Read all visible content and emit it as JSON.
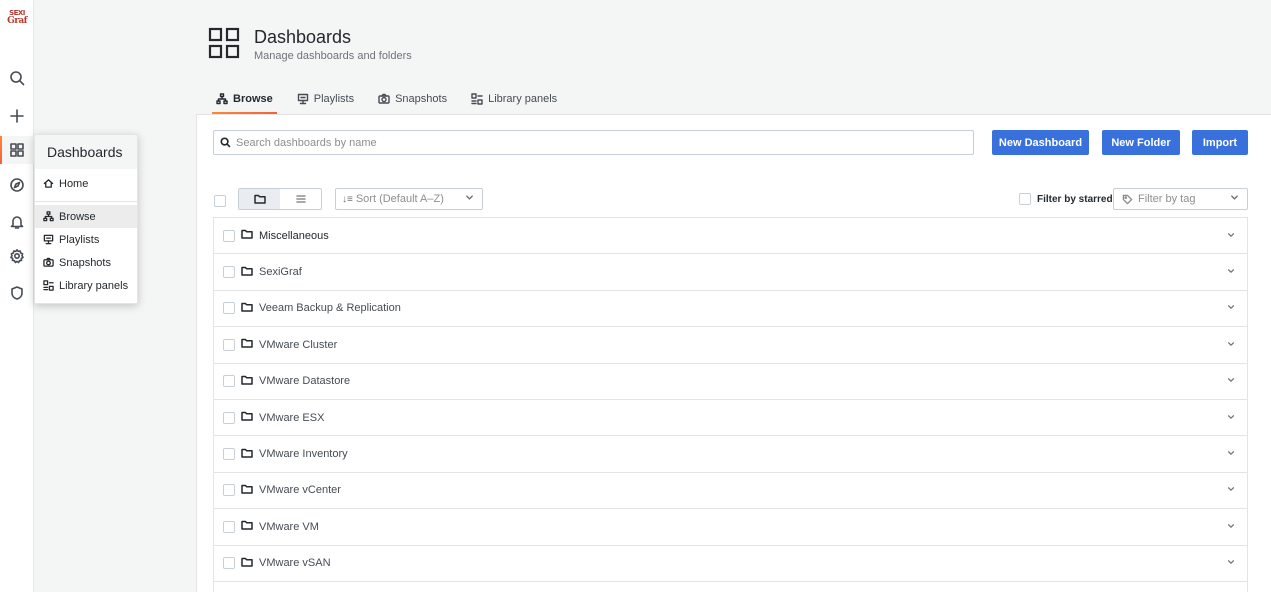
{
  "app": {
    "logo_line1": "SEXI",
    "logo_line2": "Graf"
  },
  "flyout": {
    "header": "Dashboards",
    "items": [
      {
        "label": "Home"
      },
      {
        "label": "Browse"
      },
      {
        "label": "Playlists"
      },
      {
        "label": "Snapshots"
      },
      {
        "label": "Library panels"
      }
    ]
  },
  "page": {
    "title": "Dashboards",
    "subtitle": "Manage dashboards and folders"
  },
  "tabs": [
    {
      "label": "Browse",
      "active": true
    },
    {
      "label": "Playlists"
    },
    {
      "label": "Snapshots"
    },
    {
      "label": "Library panels"
    }
  ],
  "search": {
    "placeholder": "Search dashboards by name"
  },
  "actions": {
    "new_dashboard": "New Dashboard",
    "new_folder": "New Folder",
    "import": "Import"
  },
  "toolbar": {
    "sort_label": "Sort (Default A–Z)",
    "filter_starred": "Filter by starred",
    "filter_tag_placeholder": "Filter by tag"
  },
  "folders": [
    {
      "name": "Miscellaneous"
    },
    {
      "name": "SexiGraf"
    },
    {
      "name": "Veeam Backup & Replication"
    },
    {
      "name": "VMware Cluster"
    },
    {
      "name": "VMware Datastore"
    },
    {
      "name": "VMware ESX"
    },
    {
      "name": "VMware Inventory"
    },
    {
      "name": "VMware vCenter"
    },
    {
      "name": "VMware VM"
    },
    {
      "name": "VMware vSAN"
    },
    {
      "name": ""
    }
  ],
  "colors": {
    "primary_button": "#3871dc",
    "accent": "#f55f3e"
  }
}
